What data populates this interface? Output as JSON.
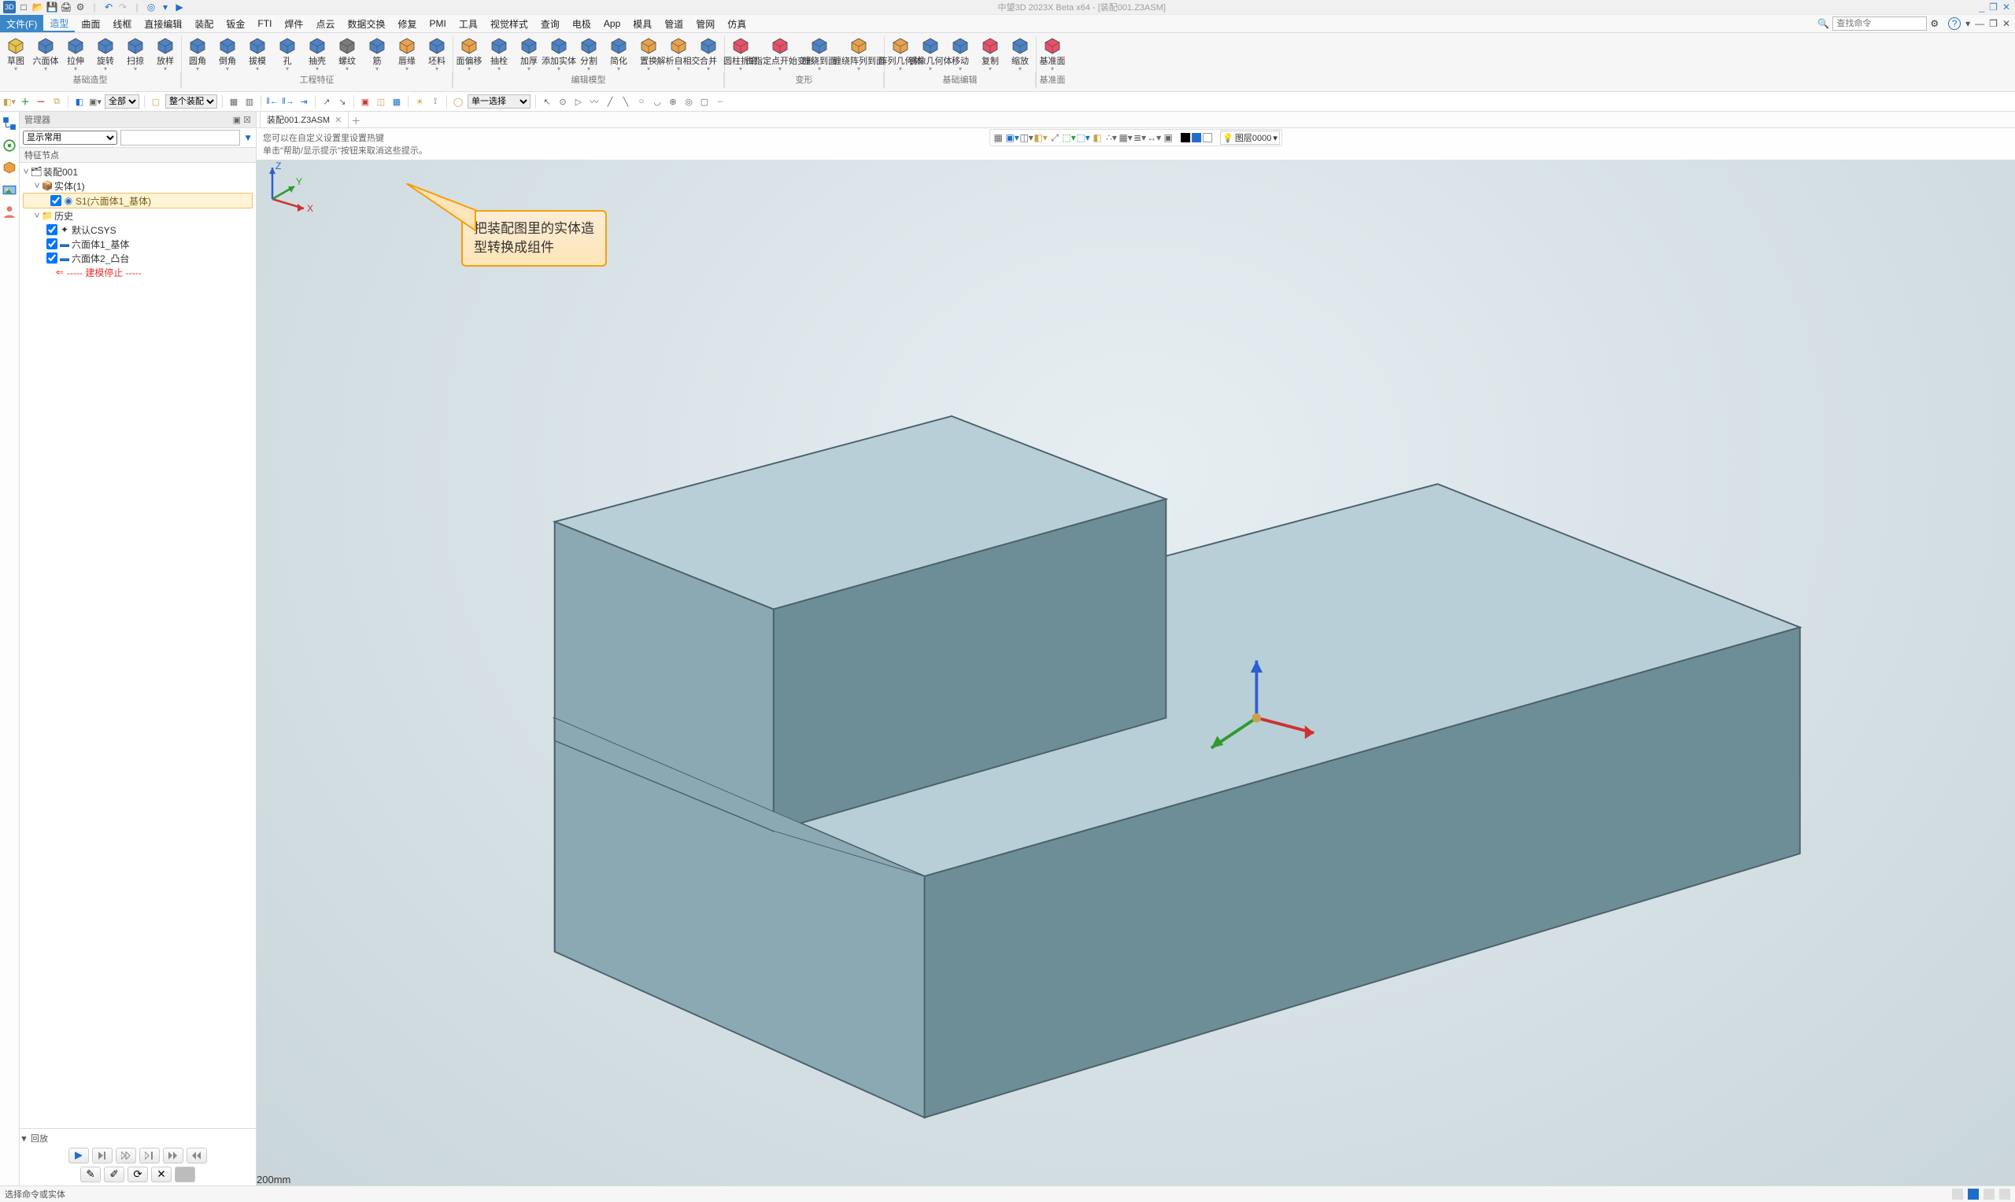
{
  "titlebar": {
    "text": "中望3D 2023X Beta x64 - [装配001.Z3ASM]"
  },
  "qat": {
    "logo": "中",
    "new": "□",
    "open": "📂",
    "save": "💾",
    "print": "🖨",
    "undo": "↶",
    "redo": "↷",
    "sep": "▾",
    "app": "◉",
    "play": "▶"
  },
  "winctrl": {
    "min": "—",
    "max": "❐",
    "close": "✕",
    "amin": "_",
    "amax": "❐",
    "aclose": "✕"
  },
  "menubar": {
    "items": [
      "文件(F)",
      "造型",
      "曲面",
      "线框",
      "直接编辑",
      "装配",
      "钣金",
      "FTI",
      "焊件",
      "点云",
      "数据交换",
      "修复",
      "PMI",
      "工具",
      "视觉样式",
      "查询",
      "电极",
      "App",
      "模具",
      "管道",
      "管网",
      "仿真"
    ],
    "active": "造型"
  },
  "search": {
    "placeholder": "查找命令",
    "icon": "🔍",
    "config": "⚙"
  },
  "help": {
    "q": "?",
    "tri": "▾"
  },
  "ribbon": {
    "groups": [
      {
        "cap": "基础造型",
        "btns": [
          {
            "l": "草图",
            "i": "sketch",
            "c": "#e9c24b"
          },
          {
            "l": "六面体",
            "i": "box",
            "c": "#4c83c7"
          },
          {
            "l": "拉伸",
            "i": "extrude",
            "c": "#4c83c7"
          },
          {
            "l": "旋转",
            "i": "revolve",
            "c": "#4c83c7"
          },
          {
            "l": "扫掠",
            "i": "sweep",
            "c": "#4c83c7"
          },
          {
            "l": "放样",
            "i": "loft",
            "c": "#4c83c7"
          }
        ]
      },
      {
        "cap": "工程特征",
        "btns": [
          {
            "l": "圆角",
            "i": "fillet",
            "c": "#4c83c7"
          },
          {
            "l": "倒角",
            "i": "chamfer",
            "c": "#4c83c7"
          },
          {
            "l": "拔模",
            "i": "draft",
            "c": "#4c83c7"
          },
          {
            "l": "孔",
            "i": "hole",
            "c": "#4c83c7"
          },
          {
            "l": "抽壳",
            "i": "shell",
            "c": "#4c83c7"
          },
          {
            "l": "螺纹",
            "i": "thread",
            "c": "#7a7a7a"
          },
          {
            "l": "筋",
            "i": "rib",
            "c": "#4c83c7"
          },
          {
            "l": "唇缘",
            "i": "lip",
            "c": "#e9a24b"
          },
          {
            "l": "坯料",
            "i": "stock",
            "c": "#4c83c7"
          }
        ]
      },
      {
        "cap": "编辑模型",
        "btns": [
          {
            "l": "面偏移",
            "i": "faceoff",
            "c": "#e9a24b"
          },
          {
            "l": "抽栓",
            "i": "pull",
            "c": "#4c83c7"
          },
          {
            "l": "加厚",
            "i": "thicken",
            "c": "#4c83c7"
          },
          {
            "l": "添加实体",
            "i": "addbody",
            "c": "#4c83c7"
          },
          {
            "l": "分割",
            "i": "split",
            "c": "#4c83c7"
          },
          {
            "l": "简化",
            "i": "simplify",
            "c": "#4c83c7"
          },
          {
            "l": "置换",
            "i": "replace",
            "c": "#e9a24b"
          },
          {
            "l": "解析自相交",
            "i": "selfint",
            "c": "#e9a24b"
          },
          {
            "l": "合并",
            "i": "combine",
            "c": "#4c83c7"
          }
        ]
      },
      {
        "cap": "变形",
        "btns": [
          {
            "l": "圆柱折弯",
            "i": "cylbend",
            "c": "#e85069"
          },
          {
            "l": "由指定点开始变形",
            "i": "ptdeform",
            "c": "#e85069",
            "w": true
          },
          {
            "l": "缠绕到面",
            "i": "wrap",
            "c": "#4c83c7"
          },
          {
            "l": "缠绕阵列到面",
            "i": "wraparray",
            "c": "#e9a24b",
            "w": true
          }
        ]
      },
      {
        "cap": "基础编辑",
        "btns": [
          {
            "l": "阵列几何体",
            "i": "pattern",
            "c": "#e9a24b"
          },
          {
            "l": "镜像几何体",
            "i": "mirror",
            "c": "#4c83c7"
          },
          {
            "l": "移动",
            "i": "move",
            "c": "#4c83c7"
          },
          {
            "l": "复制",
            "i": "copy",
            "c": "#e85069"
          },
          {
            "l": "缩放",
            "i": "scale",
            "c": "#4c83c7"
          }
        ]
      },
      {
        "cap": "基准面",
        "btns": [
          {
            "l": "基准面",
            "i": "datum",
            "c": "#e85069"
          }
        ]
      }
    ]
  },
  "toolbar2": {
    "sel1": "全部",
    "sel2": "整个装配",
    "sel3": "单一选择"
  },
  "manager": {
    "title": "管理器",
    "pin": "📌",
    "close": "✕",
    "filter_sel": "显示常用",
    "filter_placeholder": "",
    "funnel": "▼",
    "sect": "特征节点",
    "playback": "▼ 回放"
  },
  "tree": {
    "root": {
      "label": "装配001"
    },
    "entity_group": {
      "label": "实体(1)"
    },
    "entity_item": {
      "label": "S1(六面体1_基体)"
    },
    "history": {
      "label": "历史"
    },
    "csys": {
      "label": "默认CSYS"
    },
    "h1": {
      "label": "六面体1_基体"
    },
    "h2": {
      "label": "六面体2_凸台"
    },
    "stop": {
      "label": "----- 建模停止 -----"
    }
  },
  "tabs": {
    "active": "装配001.Z3ASM"
  },
  "hints": {
    "line1": "您可以在自定义设置里设置热键",
    "line2": "单击\"帮助/显示提示\"按钮来取消这些提示。"
  },
  "vtoolbar": {
    "layer_label": "图层0000",
    "bulb": "💡"
  },
  "annotation": {
    "l1": "把装配图里的实体造",
    "l2": "型转换成组件"
  },
  "coord": {
    "scale": "200mm",
    "x": "X",
    "y": "Y",
    "z": "Z"
  },
  "statusbar": {
    "text": "选择命令或实体"
  }
}
